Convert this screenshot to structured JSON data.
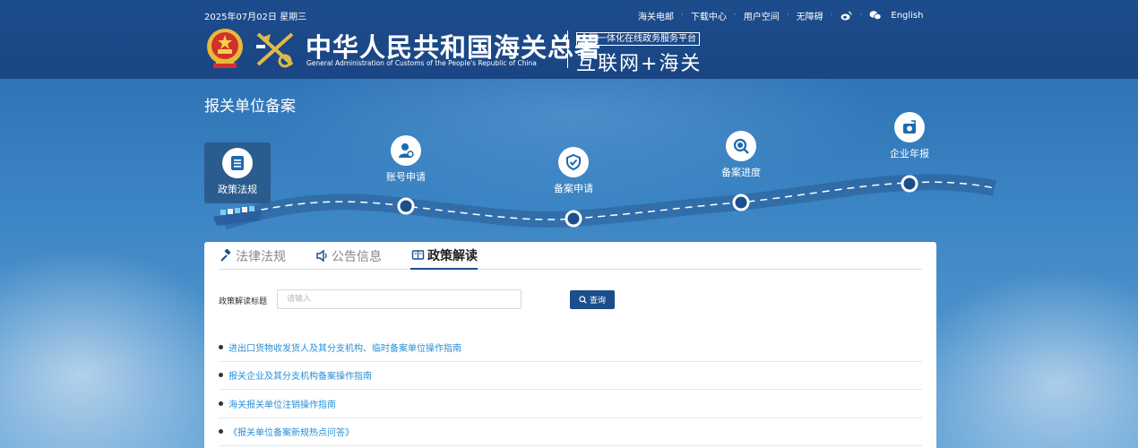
{
  "header": {
    "date": "2025年07月02日 星期三",
    "links": [
      {
        "label": "海关电邮"
      },
      {
        "label": "下载中心"
      },
      {
        "label": "用户空间"
      },
      {
        "label": "无障碍"
      }
    ],
    "icons": [
      "weibo-icon",
      "wechat-icon"
    ],
    "language": "English",
    "title_cn": "中华人民共和国海关总署",
    "title_en": "General Administration of Customs of the People's Republic of China",
    "platform_tag": "全国一体化在线政务服务平台",
    "platform_name": "互联网+海关"
  },
  "hero": {
    "page_title": "报关单位备案",
    "steps": [
      {
        "label": "政策法规",
        "icon": "document-list-icon",
        "active": true
      },
      {
        "label": "账号申请",
        "icon": "user-gear-icon",
        "active": false
      },
      {
        "label": "备案申请",
        "icon": "shield-check-icon",
        "active": false
      },
      {
        "label": "备案进度",
        "icon": "magnifier-icon",
        "active": false
      },
      {
        "label": "企业年报",
        "icon": "annual-report-icon",
        "active": false
      }
    ]
  },
  "tabs": [
    {
      "label": "法律法规",
      "icon": "gavel-icon",
      "active": false
    },
    {
      "label": "公告信息",
      "icon": "speaker-icon",
      "active": false
    },
    {
      "label": "政策解读",
      "icon": "book-icon",
      "active": true
    }
  ],
  "search": {
    "label": "政策解读标题",
    "placeholder": "请输入",
    "value": "",
    "button_label": "查询"
  },
  "items": [
    "进出口货物收发货人及其分支机构、临时备案单位操作指南",
    "报关企业及其分支机构备案操作指南",
    "海关报关单位注销操作指南",
    "《报关单位备案新规热点问答》"
  ],
  "colors": {
    "header_bg": "#1d4c8c",
    "accent": "#1b4e8b",
    "link": "#2a8fd6"
  }
}
